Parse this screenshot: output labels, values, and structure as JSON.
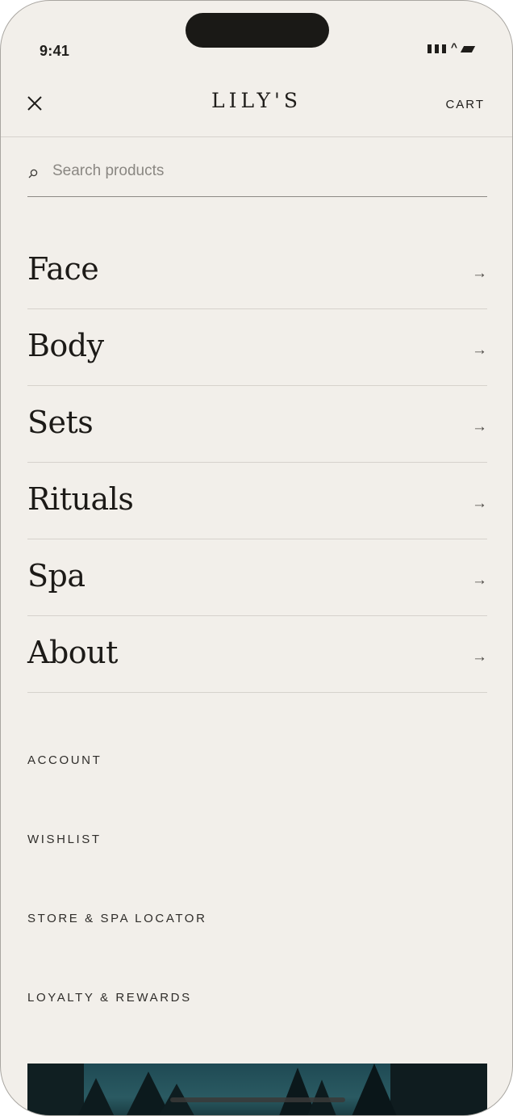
{
  "status": {
    "time": "9:41"
  },
  "header": {
    "brand": "LILY'S",
    "cart_label": "CART"
  },
  "search": {
    "placeholder": "Search products"
  },
  "nav": {
    "items": [
      {
        "label": "Face",
        "arrow": "→"
      },
      {
        "label": "Body",
        "arrow": "→"
      },
      {
        "label": "Sets",
        "arrow": "→"
      },
      {
        "label": "Rituals",
        "arrow": "→"
      },
      {
        "label": "Spa",
        "arrow": "→"
      },
      {
        "label": "About",
        "arrow": "→"
      }
    ]
  },
  "secondary": {
    "items": [
      {
        "label": "ACCOUNT"
      },
      {
        "label": "WISHLIST"
      },
      {
        "label": "STORE & SPA LOCATOR"
      },
      {
        "label": "LOYALTY & REWARDS"
      }
    ]
  },
  "icons": {
    "close": "close-icon",
    "search": "search-icon",
    "arrow": "arrow-right-icon"
  },
  "colors": {
    "background": "#f2efea",
    "text": "#1f1d1a",
    "divider": "#d6d2cc",
    "banner": "#1f4a54"
  }
}
